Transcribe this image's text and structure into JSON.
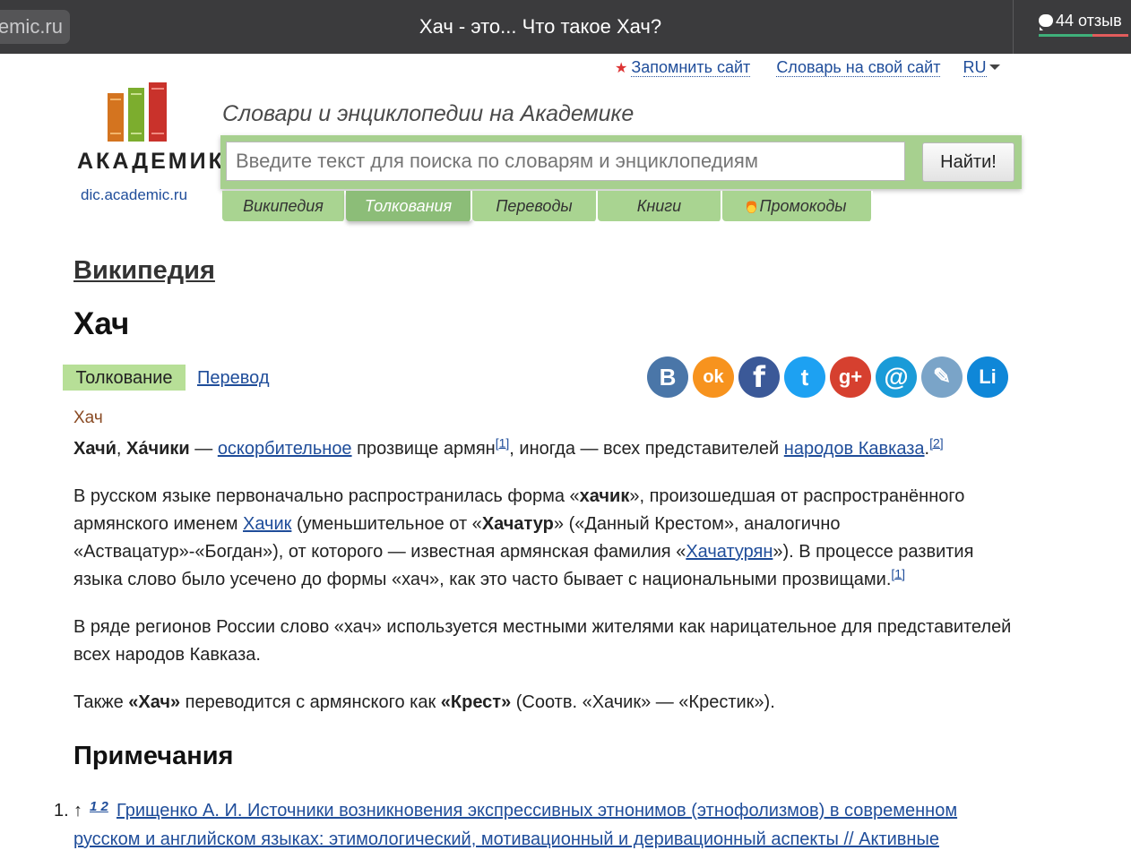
{
  "browser": {
    "url_fragment": "emic.ru",
    "page_title": "Хач - это... Что такое Хач?",
    "reviews_label": "44 отзыв"
  },
  "header": {
    "remember_site": "Запомнить сайт",
    "dictionary_on_site": "Словарь на свой сайт",
    "lang": "RU",
    "logo_text": "АКАДЕМИК",
    "logo_domain": "dic.academic.ru",
    "tagline": "Словари и энциклопедии на Академике"
  },
  "search": {
    "placeholder": "Введите текст для поиска по словарям и энциклопедиям",
    "button": "Найти!"
  },
  "tabs": [
    {
      "label": "Википедия"
    },
    {
      "label": "Толкования"
    },
    {
      "label": "Переводы"
    },
    {
      "label": "Книги"
    },
    {
      "label": "Промокоды"
    }
  ],
  "article": {
    "section": "Википедия",
    "title": "Хач",
    "tab_active": "Толкование",
    "tab_translate": "Перевод",
    "source_word": "Хач",
    "p1": {
      "w1": "Хачи́",
      "sep": ", ",
      "w2": "Ха́чики",
      "t1": " — ",
      "link1": "оскорбительное",
      "t2": " прозвище армян",
      "sup1": "[1]",
      "t3": ", иногда — всех представителей ",
      "link2": "народов Кавказа",
      "t4": ".",
      "sup2": "[2]"
    },
    "p2": {
      "t1": "В русском языке первоначально распространилась форма «",
      "b1": "хачик",
      "t2": "», произошедшая от распространённого армянского именем ",
      "link1": "Хачик",
      "t3": " (уменьшительное от «",
      "b2": "Хачатур",
      "t4": "» («Данный Крестом», аналогично «Аствацатур»-«Богдан»), от которого — известная армянская фамилия «",
      "link2": "Хачатурян",
      "t5": "»). В процессе развития языка слово было усечено до формы «хач», как это часто бывает с национальными прозвищами.",
      "sup": "[1]"
    },
    "p3": "В ряде регионов России слово «хач» используется местными жителями как нарицательное для представителей всех народов Кавказа.",
    "p4": {
      "t1": "Также ",
      "b1": "«Хач»",
      "t2": " переводится с армянского как ",
      "b2": "«Крест»",
      "t3": " (Соотв. «Хачик» — «Крестик»)."
    },
    "notes_title": "Примечания",
    "note1": {
      "num": "1.",
      "arrow": "↑",
      "back": "1 2",
      "line1": "Грищенко А. И. Источники возникновения экспрессивных этнонимов (этнофолизмов) в современном",
      "line2": "русском и английском языках: этимологический, мотивационный и деривационный аспекты // Активные"
    }
  },
  "share": {
    "buttons": [
      {
        "name": "vk",
        "glyph": "B",
        "color": "#4a76a8"
      },
      {
        "name": "odnoklassniki",
        "glyph": "ok",
        "color": "#f7931e"
      },
      {
        "name": "facebook",
        "glyph": "f",
        "color": "#3b5998"
      },
      {
        "name": "twitter",
        "glyph": "t",
        "color": "#1da1f2"
      },
      {
        "name": "google-plus",
        "glyph": "g+",
        "color": "#d6402f"
      },
      {
        "name": "mail",
        "glyph": "@",
        "color": "#1a9bd8"
      },
      {
        "name": "livejournal",
        "glyph": "✎",
        "color": "#7aa4c8"
      },
      {
        "name": "liveinternet",
        "glyph": "Li",
        "color": "#0f87d8"
      }
    ]
  }
}
